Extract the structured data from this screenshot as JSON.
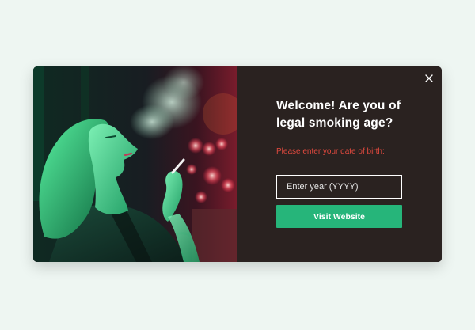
{
  "modal": {
    "close_icon": "close-icon",
    "title": "Welcome! Are you of legal smoking age?",
    "prompt": "Please enter your date of birth:",
    "year_input": {
      "placeholder": "Enter year (YYYY)",
      "value": ""
    },
    "visit_button_label": "Visit Website",
    "colors": {
      "page_background": "#eef6f2",
      "panel_background": "#2a2220",
      "prompt_text": "#e0493e",
      "button": "#26b57a"
    }
  }
}
